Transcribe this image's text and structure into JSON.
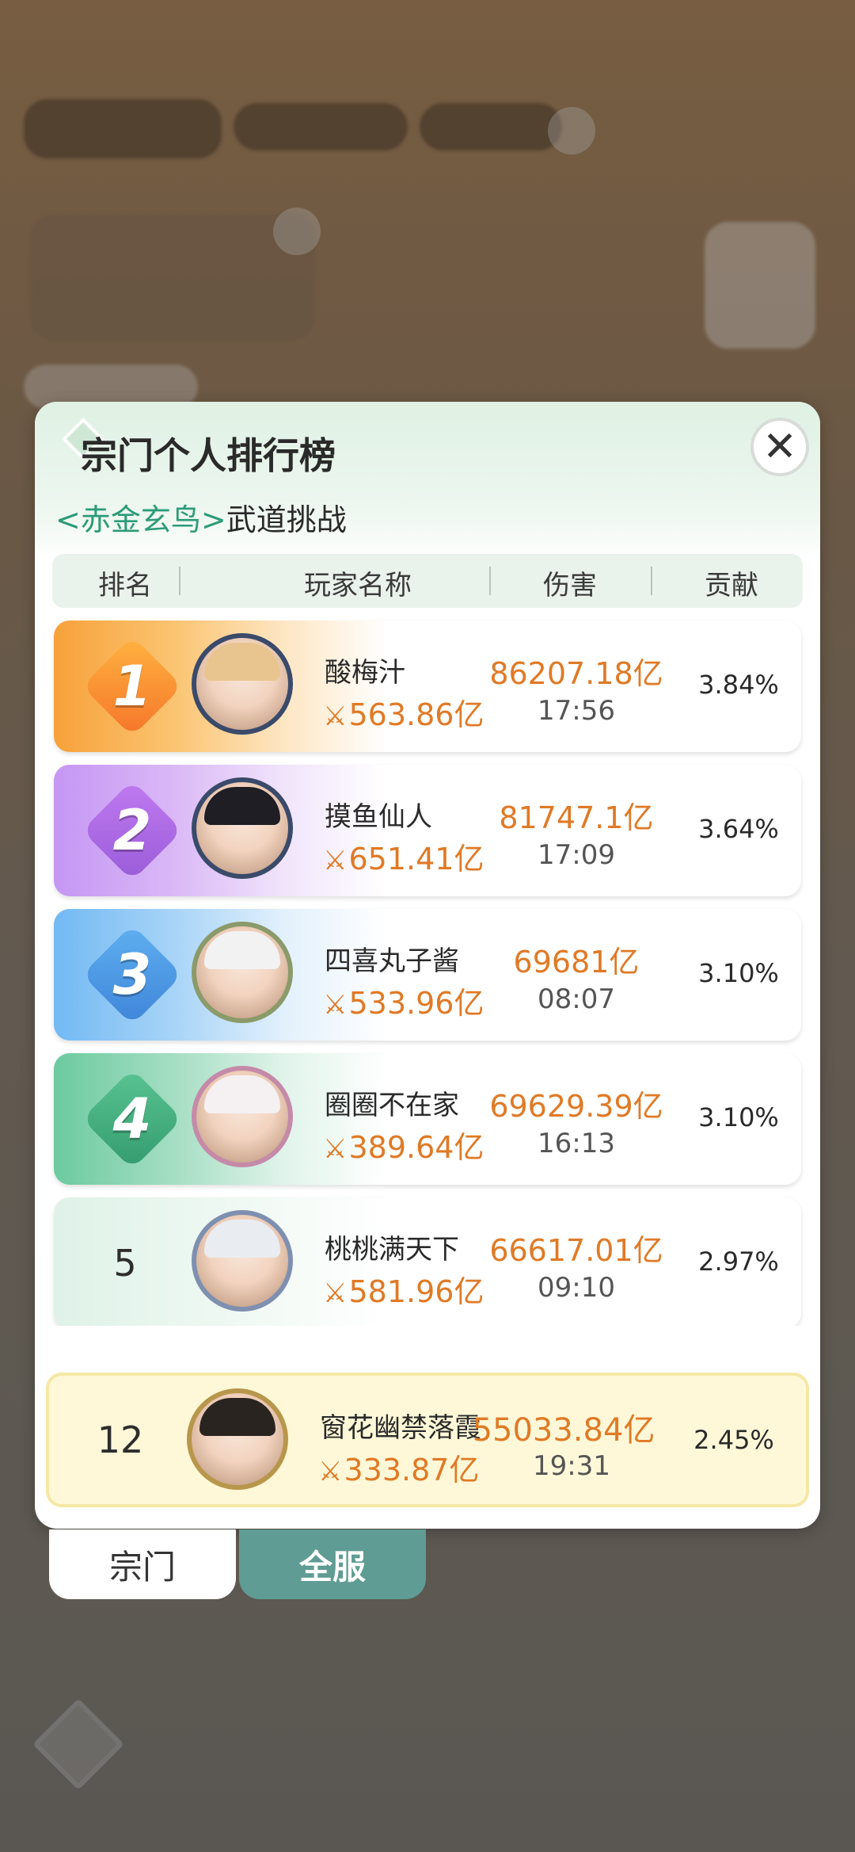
{
  "modal": {
    "title": "宗门个人排行榜",
    "close_icon": "✕",
    "subtitle_boss": "<赤金玄鸟>",
    "subtitle_mode": "武道挑战",
    "headers": {
      "rank": "排名",
      "player": "玩家名称",
      "damage": "伤害",
      "contribution": "贡献"
    }
  },
  "rankings": [
    {
      "rank": "1",
      "name": "酸梅汁",
      "power": "563.86亿",
      "damage": "86207.18亿",
      "time": "17:56",
      "contribution": "3.84%"
    },
    {
      "rank": "2",
      "name": "摸鱼仙人",
      "power": "651.41亿",
      "damage": "81747.1亿",
      "time": "17:09",
      "contribution": "3.64%"
    },
    {
      "rank": "3",
      "name": "四喜丸子酱",
      "power": "533.96亿",
      "damage": "69681亿",
      "time": "08:07",
      "contribution": "3.10%"
    },
    {
      "rank": "4",
      "name": "圈圈不在家",
      "power": "389.64亿",
      "damage": "69629.39亿",
      "time": "16:13",
      "contribution": "3.10%"
    },
    {
      "rank": "5",
      "name": "桃桃满天下",
      "power": "581.96亿",
      "damage": "66617.01亿",
      "time": "09:10",
      "contribution": "2.97%"
    }
  ],
  "self": {
    "rank": "12",
    "name": "窗花幽禁落霞",
    "power": "333.87亿",
    "damage": "55033.84亿",
    "time": "19:31",
    "contribution": "2.45%"
  },
  "tabs": {
    "sect": "宗门",
    "all": "全服"
  },
  "power_icon": "⚔",
  "colors": {
    "accent_orange": "#e07a26",
    "teal_tab": "#5f9c93",
    "boss_green": "#2c9b79"
  }
}
